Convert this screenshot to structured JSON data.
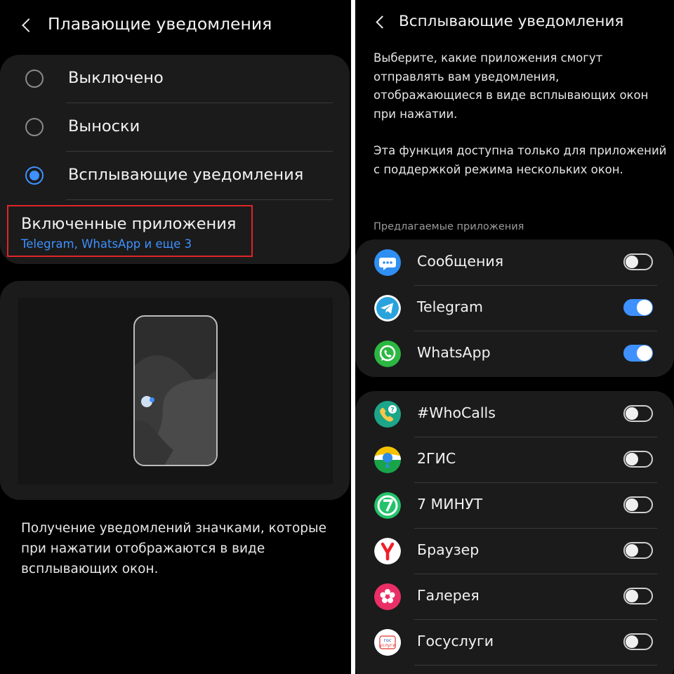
{
  "left": {
    "title": "Плавающие уведомления",
    "options": [
      {
        "label": "Выключено",
        "selected": false
      },
      {
        "label": "Выноски",
        "selected": false
      },
      {
        "label": "Всплывающие уведомления",
        "selected": true
      }
    ],
    "enabled_apps": {
      "title": "Включенные приложения",
      "subtitle": "Telegram, WhatsApp и еще 3"
    },
    "description": "Получение уведомлений значками, которые при нажатии отображаются в виде всплывающих окон."
  },
  "right": {
    "title": "Всплывающие уведомления",
    "description_1": "Выберите, какие приложения смогут отправлять вам уведомления, отображающиеся в виде всплывающих окон при нажатии.",
    "description_2": "Эта функция доступна только для приложений с поддержкой режима нескольких окон.",
    "suggested_label": "Предлагаемые приложения",
    "suggested_apps": [
      {
        "name": "Сообщения",
        "icon": "messages-icon",
        "enabled": false
      },
      {
        "name": "Telegram",
        "icon": "telegram-icon",
        "enabled": true
      },
      {
        "name": "WhatsApp",
        "icon": "whatsapp-icon",
        "enabled": true
      }
    ],
    "apps": [
      {
        "name": "#WhoCalls",
        "icon": "whocalls-icon",
        "enabled": false
      },
      {
        "name": "2ГИС",
        "icon": "2gis-icon",
        "enabled": false
      },
      {
        "name": "7 МИНУТ",
        "icon": "7-minut-icon",
        "enabled": false
      },
      {
        "name": "Браузер",
        "icon": "yandex-browser-icon",
        "enabled": false
      },
      {
        "name": "Галерея",
        "icon": "gallery-icon",
        "enabled": false
      },
      {
        "name": "Госуслуги",
        "icon": "gosuslugi-icon",
        "enabled": false
      }
    ],
    "gosuslugi_icon_text": "гос услуги"
  },
  "colors": {
    "accent": "#3e91ff",
    "highlight_border": "#e0242a",
    "card": "#1b1b1b",
    "background": "#000000"
  }
}
